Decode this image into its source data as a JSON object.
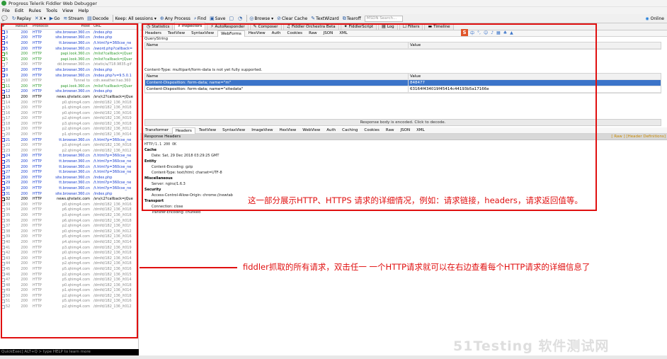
{
  "window": {
    "title": "Progress Telerik Fiddler Web Debugger"
  },
  "menu": [
    "File",
    "Edit",
    "Rules",
    "Tools",
    "View",
    "Help"
  ],
  "toolbar": {
    "items": [
      {
        "icon": "comment-icon",
        "label": ""
      },
      {
        "icon": "replay-icon",
        "label": "Replay"
      },
      {
        "icon": "remove-icon",
        "label": "X ▾"
      },
      {
        "icon": "go-icon",
        "label": "Go"
      },
      {
        "icon": "stream-icon",
        "label": "Stream"
      },
      {
        "icon": "decode-icon",
        "label": "Decode"
      },
      {
        "icon": "",
        "label": "Keep: All sessions ▾"
      },
      {
        "icon": "target-icon",
        "label": "Any Process"
      },
      {
        "icon": "find-icon",
        "label": "Find"
      },
      {
        "icon": "save-icon",
        "label": "Save"
      },
      {
        "icon": "screenshot-icon",
        "label": ""
      },
      {
        "icon": "timer-icon",
        "label": ""
      },
      {
        "icon": "browse-icon",
        "label": "Browse ▾"
      },
      {
        "icon": "clear-cache-icon",
        "label": "Clear Cache"
      },
      {
        "icon": "textwizard-icon",
        "label": "TextWizard"
      },
      {
        "icon": "tearoff-icon",
        "label": "Tearoff"
      }
    ],
    "search_placeholder": "MSDN Search...",
    "online": "Online"
  },
  "sessions": {
    "columns": [
      "#",
      "Result",
      "Protocol",
      "Host",
      "URL"
    ],
    "rows": [
      {
        "id": "3",
        "result": "200",
        "protocol": "HTTP",
        "host": "site.browser.360.cn",
        "url": "/index.php",
        "color": "#1a3fcf"
      },
      {
        "id": "2",
        "result": "200",
        "protocol": "HTTP",
        "host": "site.browser.360.cn",
        "url": "/index.php",
        "color": "#1a3fcf"
      },
      {
        "id": "4",
        "result": "200",
        "protocol": "HTTP",
        "host": "tt.browser.360.cn",
        "url": "/t.html?p=360cse_ne",
        "color": "#1a3fcf"
      },
      {
        "id": "5",
        "result": "200",
        "protocol": "HTTP",
        "host": "site.browser.360.cn",
        "url": "/sword.php?callback=",
        "color": "#1a3fcf"
      },
      {
        "id": "6",
        "result": "200",
        "protocol": "HTTP",
        "host": "papi.look.360.cn",
        "url": "/mlist?callback=jQuer",
        "color": "#2e9a2e"
      },
      {
        "id": "5",
        "result": "200",
        "protocol": "HTTP",
        "host": "papi.look.360.cn",
        "url": "/mlist?callback=jQuer",
        "color": "#2e9a2e"
      },
      {
        "id": "7",
        "result": "200",
        "protocol": "HTTP",
        "host": "dd.browser.360.cn",
        "url": "/static/a/718.9835.gif",
        "color": "#888888"
      },
      {
        "id": "8",
        "result": "200",
        "protocol": "HTTP",
        "host": "site.browser.360.cn",
        "url": "/index.php",
        "color": "#1a3fcf"
      },
      {
        "id": "9",
        "result": "200",
        "protocol": "HTTP",
        "host": "site.browser.360.cn",
        "url": "/index.php?v=9.5.0.1",
        "color": "#1a3fcf"
      },
      {
        "id": "10",
        "result": "200",
        "protocol": "HTTP",
        "host": "Tunnel to",
        "url": "cdn.weather.hao.360",
        "color": "#888888"
      },
      {
        "id": "11",
        "result": "200",
        "protocol": "HTTP",
        "host": "papi.look.360.cn",
        "url": "/mlist?callback=jQuer",
        "color": "#2e9a2e"
      },
      {
        "id": "12",
        "result": "200",
        "protocol": "HTTP",
        "host": "site.browser.360.cn",
        "url": "/index.php",
        "color": "#1a3fcf"
      },
      {
        "id": "13",
        "result": "200",
        "protocol": "HTTP",
        "host": "news.qhstatic.com",
        "url": "/srv/c2?callback=jQue",
        "color": "#000000"
      },
      {
        "id": "14",
        "result": "200",
        "protocol": "HTTP",
        "host": "p0.qhimg4.com",
        "url": "/dmfd/182_136_/t018",
        "color": "#888888"
      },
      {
        "id": "15",
        "result": "200",
        "protocol": "HTTP",
        "host": "p1.qhimg4.com",
        "url": "/dmfd/182_136_/t018",
        "color": "#888888"
      },
      {
        "id": "16",
        "result": "200",
        "protocol": "HTTP",
        "host": "p0.qhimg4.com",
        "url": "/dmfd/182_136_/t016",
        "color": "#888888"
      },
      {
        "id": "17",
        "result": "200",
        "protocol": "HTTP",
        "host": "p2.qhimg4.com",
        "url": "/dmfd/182_136_/t019",
        "color": "#888888"
      },
      {
        "id": "18",
        "result": "200",
        "protocol": "HTTP",
        "host": "p3.qhimg4.com",
        "url": "/dmfd/182_136_/t018",
        "color": "#888888"
      },
      {
        "id": "19",
        "result": "200",
        "protocol": "HTTP",
        "host": "p2.qhimg4.com",
        "url": "/dmfd/182_136_/t012",
        "color": "#888888"
      },
      {
        "id": "20",
        "result": "200",
        "protocol": "HTTP",
        "host": "p1.qhimg4.com",
        "url": "/dmfd/182_136_/t014",
        "color": "#888888"
      },
      {
        "id": "21",
        "result": "200",
        "protocol": "HTTP",
        "host": "tt.browser.360.cn",
        "url": "/t.html?p=360cse_ne",
        "color": "#1a3fcf"
      },
      {
        "id": "22",
        "result": "200",
        "protocol": "HTTP",
        "host": "p3.qhimg4.com",
        "url": "/dmfd/182_136_/t018",
        "color": "#888888"
      },
      {
        "id": "23",
        "result": "200",
        "protocol": "HTTP",
        "host": "p2.qhimg4.com",
        "url": "/dmfd/182_136_/t012",
        "color": "#888888"
      },
      {
        "id": "24",
        "result": "200",
        "protocol": "HTTP",
        "host": "tt.browser.360.cn",
        "url": "/t.html?p=360cse_ne",
        "color": "#1a3fcf"
      },
      {
        "id": "25",
        "result": "200",
        "protocol": "HTTP",
        "host": "tt.browser.360.cn",
        "url": "/t.html?p=360cse_ne",
        "color": "#1a3fcf"
      },
      {
        "id": "26",
        "result": "200",
        "protocol": "HTTP",
        "host": "tt.browser.360.cn",
        "url": "/t.html?p=360cse_ne",
        "color": "#1a3fcf"
      },
      {
        "id": "27",
        "result": "200",
        "protocol": "HTTP",
        "host": "tt.browser.360.cn",
        "url": "/t.html?p=360cse_ne",
        "color": "#1a3fcf"
      },
      {
        "id": "28",
        "result": "200",
        "protocol": "HTTP",
        "host": "site.browser.360.cn",
        "url": "/index.php",
        "color": "#1a3fcf"
      },
      {
        "id": "29",
        "result": "200",
        "protocol": "HTTP",
        "host": "tt.browser.360.cn",
        "url": "/t.html?p=360cse_ne",
        "color": "#1a3fcf"
      },
      {
        "id": "30",
        "result": "200",
        "protocol": "HTTP",
        "host": "tt.browser.360.cn",
        "url": "/t.html?p=360cse_ne",
        "color": "#1a3fcf"
      },
      {
        "id": "31",
        "result": "200",
        "protocol": "HTTP",
        "host": "site.browser.360.cn",
        "url": "/index.php",
        "color": "#1a3fcf"
      },
      {
        "id": "32",
        "result": "200",
        "protocol": "HTTP",
        "host": "news.qhstatic.com",
        "url": "/srv/c2?callback=jQue",
        "color": "#000000"
      },
      {
        "id": "33",
        "result": "200",
        "protocol": "HTTP",
        "host": "p0.qhimg4.com",
        "url": "/dmfd/182_136_/t016",
        "color": "#888888"
      },
      {
        "id": "34",
        "result": "200",
        "protocol": "HTTP",
        "host": "p6.qhimg4.com",
        "url": "/dmfd/182_136_/t018",
        "color": "#888888"
      },
      {
        "id": "35",
        "result": "200",
        "protocol": "HTTP",
        "host": "p3.qhimg4.com",
        "url": "/dmfd/182_136_/t018",
        "color": "#888888"
      },
      {
        "id": "36",
        "result": "200",
        "protocol": "HTTP",
        "host": "p6.qhimg4.com",
        "url": "/dmfd/182_136_/t018",
        "color": "#888888"
      },
      {
        "id": "37",
        "result": "200",
        "protocol": "HTTP",
        "host": "p2.qhimg4.com",
        "url": "/dmfd/182_136_/t01f",
        "color": "#888888"
      },
      {
        "id": "38",
        "result": "200",
        "protocol": "HTTP",
        "host": "p0.qhimg4.com",
        "url": "/dmfd/182_136_/t012",
        "color": "#888888"
      },
      {
        "id": "39",
        "result": "200",
        "protocol": "HTTP",
        "host": "p5.qhimg4.com",
        "url": "/dmfd/182_136_/t016",
        "color": "#888888"
      },
      {
        "id": "40",
        "result": "200",
        "protocol": "HTTP",
        "host": "p4.qhimg4.com",
        "url": "/dmfd/182_136_/t014",
        "color": "#888888"
      },
      {
        "id": "41",
        "result": "200",
        "protocol": "HTTP",
        "host": "p3.qhimg4.com",
        "url": "/dmfd/182_136_/t019",
        "color": "#888888"
      },
      {
        "id": "42",
        "result": "200",
        "protocol": "HTTP",
        "host": "p0.qhimg4.com",
        "url": "/dmfd/182_136_/t018",
        "color": "#888888"
      },
      {
        "id": "43",
        "result": "200",
        "protocol": "HTTP",
        "host": "p1.qhimg4.com",
        "url": "/dmfd/182_136_/t014",
        "color": "#888888"
      },
      {
        "id": "44",
        "result": "200",
        "protocol": "HTTP",
        "host": "p2.qhimg4.com",
        "url": "/dmfd/182_136_/t018",
        "color": "#888888"
      },
      {
        "id": "45",
        "result": "200",
        "protocol": "HTTP",
        "host": "p5.qhimg4.com",
        "url": "/dmfd/182_136_/t016",
        "color": "#888888"
      },
      {
        "id": "46",
        "result": "200",
        "protocol": "HTTP",
        "host": "p2.qhimg4.com",
        "url": "/dmfd/182_136_/t015",
        "color": "#888888"
      },
      {
        "id": "47",
        "result": "200",
        "protocol": "HTTP",
        "host": "p5.qhimg4.com",
        "url": "/dmfd/182_136_/t014",
        "color": "#888888"
      },
      {
        "id": "48",
        "result": "200",
        "protocol": "HTTP",
        "host": "p0.qhimg4.com",
        "url": "/dmfd/182_136_/t018",
        "color": "#888888"
      },
      {
        "id": "49",
        "result": "200",
        "protocol": "HTTP",
        "host": "p1.qhimg4.com",
        "url": "/dmfd/182_136_/t014",
        "color": "#888888"
      },
      {
        "id": "50",
        "result": "200",
        "protocol": "HTTP",
        "host": "p2.qhimg4.com",
        "url": "/dmfd/182_136_/t018",
        "color": "#888888"
      },
      {
        "id": "51",
        "result": "200",
        "protocol": "HTTP",
        "host": "p5.qhimg4.com",
        "url": "/dmfd/182_136_/t016",
        "color": "#888888"
      },
      {
        "id": "52",
        "result": "200",
        "protocol": "HTTP",
        "host": "p2.qhimg4.com",
        "url": "/dmfd/182_136_/t012",
        "color": "#888888"
      }
    ]
  },
  "quickexec": "QuickExec] ALT+Q > type HELP to learn more",
  "top_tabs": [
    {
      "icon": "statistics-icon",
      "label": "Statistics"
    },
    {
      "icon": "inspectors-icon",
      "label": "Inspectors",
      "active": true
    },
    {
      "icon": "autoresponder-icon",
      "label": "AutoResponder"
    },
    {
      "icon": "composer-icon",
      "label": "Composer"
    },
    {
      "icon": "orchestra-icon",
      "label": "Fiddler Orchestra Beta"
    },
    {
      "icon": "fiddlerscript-icon",
      "label": "FiddlerScript"
    },
    {
      "icon": "log-icon",
      "label": "Log"
    },
    {
      "icon": "filters-icon",
      "label": "Filters"
    },
    {
      "icon": "timeline-icon",
      "label": "Timeline"
    }
  ],
  "request_tabs": [
    "Headers",
    "TextView",
    "SyntaxView",
    "WebForms",
    "HexView",
    "Auth",
    "Cookies",
    "Raw",
    "JSON",
    "XML"
  ],
  "request": {
    "querystring_label": "QueryString",
    "columns": [
      "Name",
      "Value"
    ],
    "body_label": "Content-Type: multipart/form-data is not yet fully supported.",
    "rows": [
      {
        "name": "Content-Disposition: form-data; name=\"m\"",
        "value": "848477",
        "selected": true
      },
      {
        "name": "Content-Disposition: form-data; name=\"sitedata\"",
        "value": "63164f434019f45414c44193b5a17166e",
        "selected": false
      }
    ]
  },
  "response_notice": "Response body is encoded. Click to decode.",
  "response_tabs": [
    "Transformer",
    "Headers",
    "TextView",
    "SyntaxView",
    "ImageView",
    "HexView",
    "WebView",
    "Auth",
    "Caching",
    "Cookies",
    "Raw",
    "JSON",
    "XML"
  ],
  "response": {
    "title": "Response Headers",
    "links": "[ Raw ]   [Header Definitions]",
    "status_line": "HTTP/1.1 200 OK",
    "sections": [
      {
        "name": "Cache",
        "items": [
          "Date: Sat, 29 Dec 2018 03:29:25 GMT"
        ]
      },
      {
        "name": "Entity",
        "items": [
          "Content-Encoding: gzip",
          "Content-Type: text/html; charset=UTF-8"
        ]
      },
      {
        "name": "Miscellaneous",
        "items": [
          "Server: nginx/1.6.3"
        ]
      },
      {
        "name": "Security",
        "items": [
          "Access-Control-Allow-Origin: chrome://newtab"
        ]
      },
      {
        "name": "Transport",
        "items": [
          "Connection: close",
          "Transfer-Encoding: chunked"
        ]
      }
    ]
  },
  "annotations": {
    "right_text": "这一部分展示HTTP、HTTPS 请求的详细情况，例如：请求链接，headers，请求返回值等。",
    "left_text": "fiddler抓取的所有请求，双击任一 一个HTTP请求就可以在右边查看每个HTTP请求的详细信息了"
  },
  "watermark": "51Testing 软件测试网",
  "colors": {
    "annotation": "#e01010",
    "selection": "#3b74c9"
  }
}
